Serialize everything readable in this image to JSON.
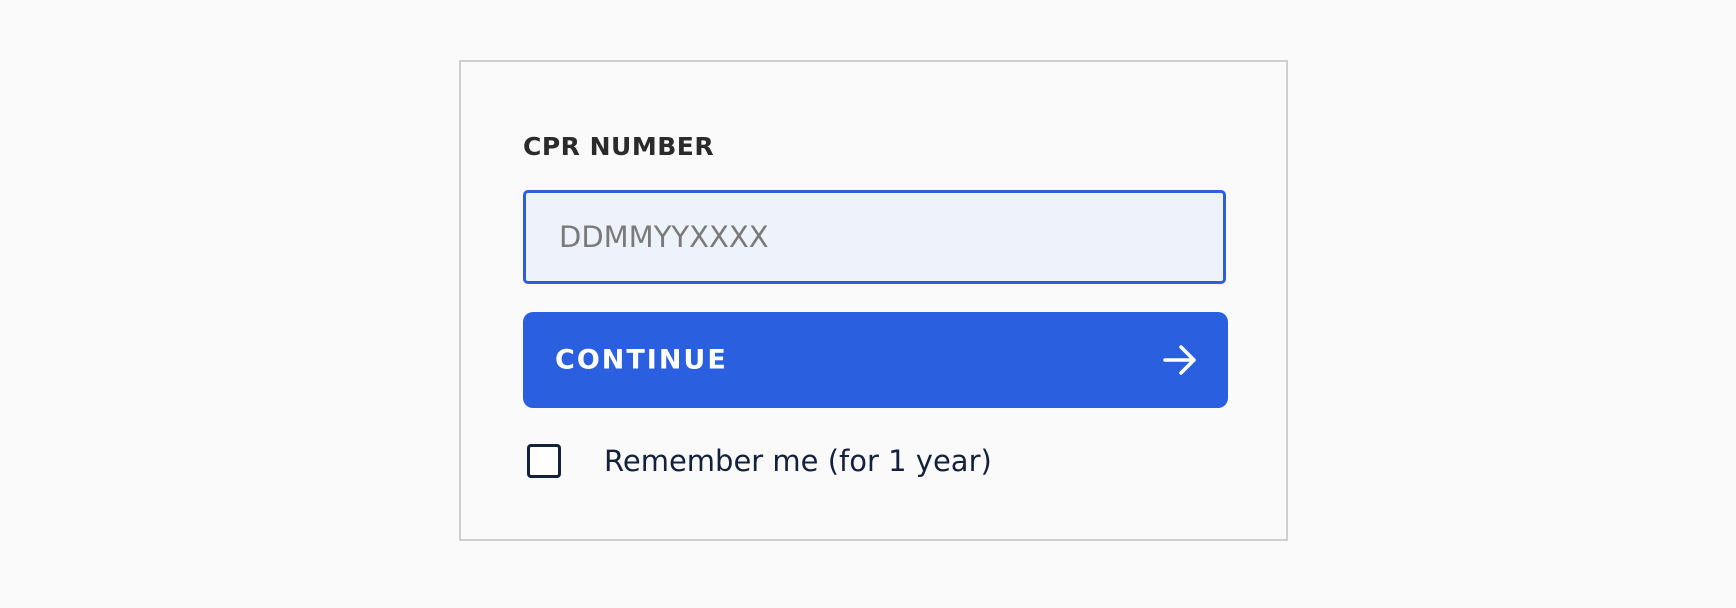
{
  "form": {
    "field_label": "CPR NUMBER",
    "cpr_input": {
      "value": "",
      "placeholder": "DDMMYYXXXX"
    },
    "continue_label": "CONTINUE",
    "continue_icon": "arrow-right-icon",
    "remember": {
      "label": "Remember me (for 1 year)",
      "checked": false
    }
  },
  "colors": {
    "page_background": "#fafafa",
    "card_border": "#cfcfcf",
    "input_border": "#2c5fdc",
    "input_background": "#eef3fb",
    "primary": "#2a5fdf",
    "primary_text": "#ffffff",
    "text_dark": "#14213d",
    "label_text": "#2b2b2b",
    "placeholder_text": "#7a7a7a"
  }
}
